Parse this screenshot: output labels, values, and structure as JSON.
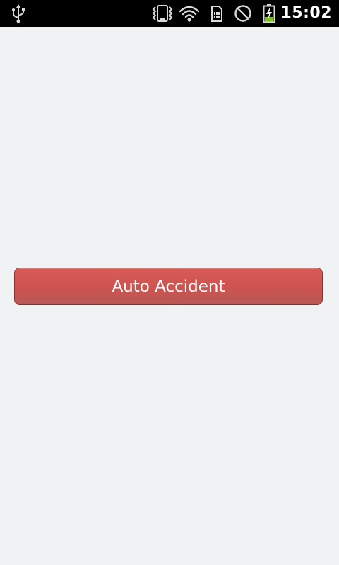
{
  "status_bar": {
    "time": "15:02",
    "icons": [
      "usb-icon",
      "vibrate-icon",
      "wifi-icon",
      "sim-card-icon",
      "do-not-disturb-icon",
      "battery-charging-icon"
    ]
  },
  "main": {
    "button_label": "Auto Accident"
  },
  "colors": {
    "status_bar_bg": "#000000",
    "page_bg": "#f1f2f4",
    "button_bg": "#cd5450",
    "button_text": "#ffffff",
    "battery_level": "#7cc21f"
  }
}
